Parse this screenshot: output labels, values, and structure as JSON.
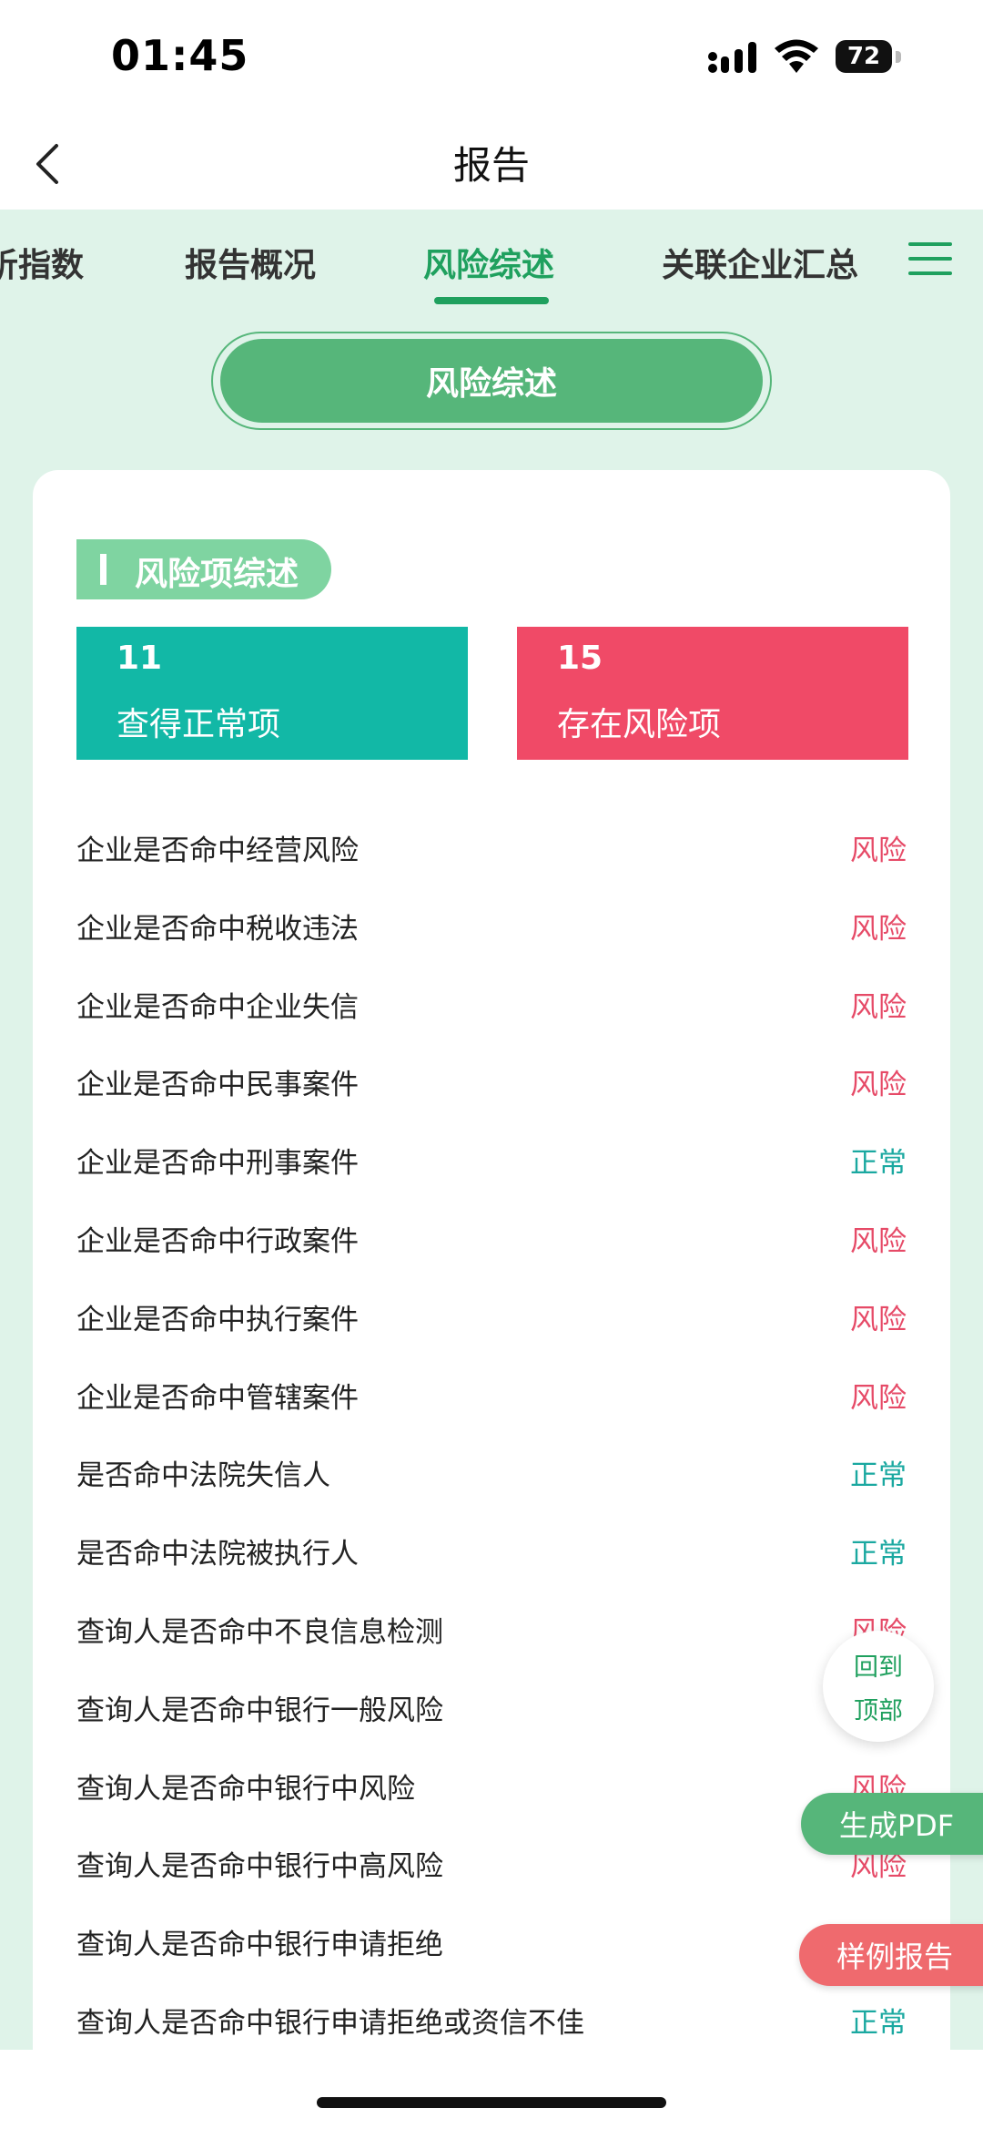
{
  "status_bar": {
    "time": "01:45",
    "battery": "72"
  },
  "nav": {
    "title": "报告"
  },
  "tabs": [
    {
      "label": "析指数"
    },
    {
      "label": "报告概况"
    },
    {
      "label": "风险综述",
      "active": true
    },
    {
      "label": "关联企业汇总"
    }
  ],
  "section": {
    "label": "风险综述"
  },
  "card": {
    "subhead": "风险项综述",
    "stats": {
      "ok": {
        "count": "11",
        "label": "查得正常项",
        "color": "#12b8a6"
      },
      "risk": {
        "count": "15",
        "label": "存在风险项",
        "color": "#f04a67"
      }
    },
    "rows": [
      {
        "q": "企业是否命中经营风险",
        "r": "风险",
        "s": "risk"
      },
      {
        "q": "企业是否命中税收违法",
        "r": "风险",
        "s": "risk"
      },
      {
        "q": "企业是否命中企业失信",
        "r": "风险",
        "s": "risk"
      },
      {
        "q": "企业是否命中民事案件",
        "r": "风险",
        "s": "risk"
      },
      {
        "q": "企业是否命中刑事案件",
        "r": "正常",
        "s": "ok"
      },
      {
        "q": "企业是否命中行政案件",
        "r": "风险",
        "s": "risk"
      },
      {
        "q": "企业是否命中执行案件",
        "r": "风险",
        "s": "risk"
      },
      {
        "q": "企业是否命中管辖案件",
        "r": "风险",
        "s": "risk"
      },
      {
        "q": "是否命中法院失信人",
        "r": "正常",
        "s": "ok"
      },
      {
        "q": "是否命中法院被执行人",
        "r": "正常",
        "s": "ok"
      },
      {
        "q": "查询人是否命中不良信息检测",
        "r": "风险",
        "s": "risk"
      },
      {
        "q": "查询人是否命中银行一般风险",
        "r": "",
        "s": "risk"
      },
      {
        "q": "查询人是否命中银行中风险",
        "r": "风险",
        "s": "risk"
      },
      {
        "q": "查询人是否命中银行中高风险",
        "r": "风险",
        "s": "risk"
      },
      {
        "q": "查询人是否命中银行申请拒绝",
        "r": "",
        "s": "risk"
      },
      {
        "q": "查询人是否命中银行申请拒绝或资信不佳",
        "r": "正常",
        "s": "ok"
      }
    ]
  },
  "floating": {
    "back_to_top_line1": "回到",
    "back_to_top_line2": "顶部",
    "pdf": "生成PDF",
    "sample": "样例报告"
  },
  "colors": {
    "accent": "#1fa05e",
    "risk": "#e64a67",
    "ok": "#1aa8a0"
  }
}
